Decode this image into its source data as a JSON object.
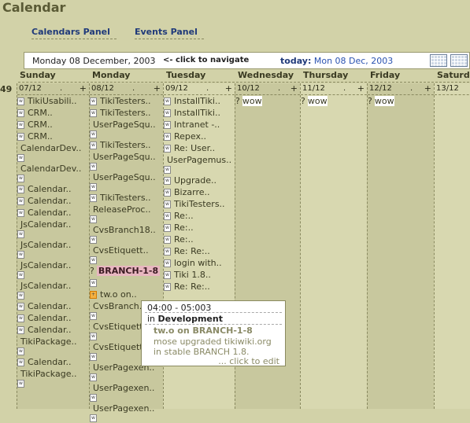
{
  "page": {
    "title": "Calendar"
  },
  "panels": {
    "calendars": "Calendars Panel",
    "events": "Events Panel"
  },
  "nav": {
    "current_date": "Monday 08 December, 2003",
    "arrow_hint": "<- click to navigate",
    "today_label": "today:",
    "today_value": "Mon 08 Dec, 2003",
    "icons": [
      "calendar-month-icon",
      "calendar-week-icon"
    ]
  },
  "days": [
    "Sunday",
    "Monday",
    "Tuesday",
    "Wednesday",
    "Thursday",
    "Friday",
    "Saturday"
  ],
  "week_number": "49",
  "columns": [
    {
      "date": "07/12",
      "dot": ".",
      "plus": "+",
      "events": [
        {
          "t": "TikiUsabili.."
        },
        {
          "t": "CRM.."
        },
        {
          "t": "CRM.."
        },
        {
          "t": "CRM.."
        },
        {
          "t": "CalendarDev..",
          "tall": true
        },
        {
          "t": "CalendarDev..",
          "tall": true
        },
        {
          "t": "Calendar.."
        },
        {
          "t": "Calendar.."
        },
        {
          "t": "Calendar.."
        },
        {
          "t": "JsCalendar..",
          "tall": true
        },
        {
          "t": "JsCalendar..",
          "tall": true
        },
        {
          "t": "JsCalendar..",
          "tall": true
        },
        {
          "t": "JsCalendar..",
          "tall": true
        },
        {
          "t": "Calendar.."
        },
        {
          "t": "Calendar.."
        },
        {
          "t": "Calendar.."
        },
        {
          "t": "TikiPackage..",
          "tall": true
        },
        {
          "t": "Calendar.."
        },
        {
          "t": "TikiPackage..",
          "tall": true
        }
      ]
    },
    {
      "date": "08/12",
      "dot": ".",
      "plus": "+",
      "events": [
        {
          "t": "TikiTesters.."
        },
        {
          "t": "TikiTesters.."
        },
        {
          "t": "UserPageSqu..",
          "tall": true
        },
        {
          "t": "TikiTesters.."
        },
        {
          "t": "UserPageSqu..",
          "tall": true
        },
        {
          "t": "UserPageSqu..",
          "tall": true
        },
        {
          "t": "TikiTesters.."
        },
        {
          "t": "ReleaseProc..",
          "tall": true
        },
        {
          "t": "CvsBranch18..",
          "tall": true
        },
        {
          "t": "CvsEtiquett..",
          "tall": true
        },
        {
          "t": "BRANCH-1-8",
          "q": "?",
          "hl": true
        },
        {
          "t": "",
          "wonly": true
        },
        {
          "t": "tw.o on..",
          "focus": true
        },
        {
          "t": "CvsBranch..",
          "tall": true
        },
        {
          "t": "CvsEtiquett..",
          "tall": true
        },
        {
          "t": "CvsEtiquett..",
          "tall": true
        },
        {
          "t": "UserPagexen..",
          "tall": true
        },
        {
          "t": "UserPagexen..",
          "tall": true
        },
        {
          "t": "UserPagexen..",
          "tall": true
        }
      ]
    },
    {
      "date": "09/12",
      "dot": ".",
      "plus": "+",
      "events": [
        {
          "t": "InstallTiki.."
        },
        {
          "t": "InstallTiki.."
        },
        {
          "t": "Intranet -.."
        },
        {
          "t": "Repex.."
        },
        {
          "t": "Re: User.."
        },
        {
          "t": "UserPagemus..",
          "tall": true
        },
        {
          "t": "Upgrade.."
        },
        {
          "t": "Bizarre.."
        },
        {
          "t": "TikiTesters.."
        },
        {
          "t": "Re:.."
        },
        {
          "t": "Re:.."
        },
        {
          "t": "Re:.."
        },
        {
          "t": "Re: Re:.."
        },
        {
          "t": "login with.."
        },
        {
          "t": "Tiki 1.8.."
        },
        {
          "t": "Re: Re:.."
        }
      ]
    },
    {
      "date": "10/12",
      "dot": ".",
      "plus": "+",
      "events": [
        {
          "t": "wow",
          "q": "?",
          "sel": true
        }
      ]
    },
    {
      "date": "11/12",
      "dot": ".",
      "plus": "+",
      "events": [
        {
          "t": "wow",
          "q": "?",
          "sel": true
        }
      ]
    },
    {
      "date": "12/12",
      "dot": ".",
      "plus": "+",
      "events": [
        {
          "t": "wow",
          "q": "?",
          "sel": true
        }
      ]
    },
    {
      "date": "13/12",
      "dot": "",
      "plus": "",
      "events": []
    }
  ],
  "tooltip": {
    "time": "04:00 - 05:003",
    "in_label": "in",
    "calendar": "Development",
    "title": "tw.o on BRANCH-1-8",
    "description": "mose upgraded tikiwiki.org in stable BRANCH 1.8.",
    "edit_hint": "... click to edit"
  },
  "colors": {
    "background": "#d2d2a8",
    "link": "#203a7a",
    "highlight": "#e8b6c0"
  }
}
